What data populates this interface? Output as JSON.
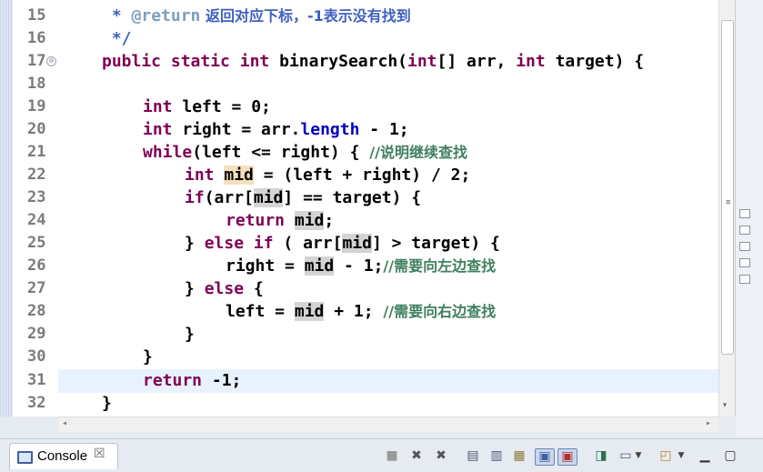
{
  "editor": {
    "line_numbers": [
      "15",
      "16",
      "17",
      "18",
      "19",
      "20",
      "21",
      "22",
      "23",
      "24",
      "25",
      "26",
      "27",
      "28",
      "29",
      "30",
      "31",
      "32"
    ],
    "fold_marker": "⊖",
    "javadoc": {
      "star": " * ",
      "tag": "@return",
      "text": " 返回对应下标，-1表示没有找到",
      "close": " */"
    },
    "code": {
      "l17_public": "public",
      "l17_static": "static",
      "l17_int": "int",
      "l17_name": "binarySearch(",
      "l17_int2": "int",
      "l17_arr": "[] arr, ",
      "l17_int3": "int",
      "l17_rest": " target) {",
      "l19_int": "int",
      "l19_rest": " left = 0;",
      "l20_int": "int",
      "l20_mid": " right = arr.",
      "l20_length": "length",
      "l20_rest": " - 1;",
      "l21_while": "while",
      "l21_rest": "(left <= right) { ",
      "l21_comment": "//说明继续查找",
      "l22_int": "int",
      "l22_mid": "mid",
      "l22_rest": " = (left + right) / 2;",
      "l23_if": "if",
      "l23_pre": "(arr[",
      "l23_mid": "mid",
      "l23_rest": "] == target) {",
      "l24_return": "return",
      "l24_mid": "mid",
      "l24_rest": ";",
      "l25_pre": "} ",
      "l25_else": "else",
      "l25_if": "if",
      "l25_arr": " ( arr[",
      "l25_mid": "mid",
      "l25_rest": "] > target) {",
      "l26_pre": "right = ",
      "l26_mid": "mid",
      "l26_rest": " - 1;",
      "l26_comment": "//需要向左边查找",
      "l27_pre": "} ",
      "l27_else": "else",
      "l27_rest": " {",
      "l28_pre": "left = ",
      "l28_mid": "mid",
      "l28_rest": " + 1; ",
      "l28_comment": "//需要向右边查找",
      "l29": "}",
      "l30": "}",
      "l31_return": "return",
      "l31_rest": " -1;",
      "l32": "}"
    }
  },
  "console": {
    "tab_label": "Console",
    "close_glyph": "☒"
  },
  "toolbar_icons": [
    "terminate-icon",
    "remove-launch-icon",
    "remove-all-icon",
    "clear-console-icon",
    "scroll-lock-icon",
    "word-wrap-icon",
    "show-on-stdout-icon",
    "show-on-stderr-icon",
    "pin-console-icon",
    "display-console-icon",
    "open-console-icon",
    "minimize-icon",
    "maximize-icon"
  ],
  "colors": {
    "keyword": "#7f0055",
    "comment": "#3f7f5f",
    "javadoc": "#3f5fbf",
    "field": "#0000c0",
    "current_line": "#e8f2fe",
    "occurrence_highlight": "#d4d4d4",
    "declaration_highlight": "#f6dfbd"
  }
}
